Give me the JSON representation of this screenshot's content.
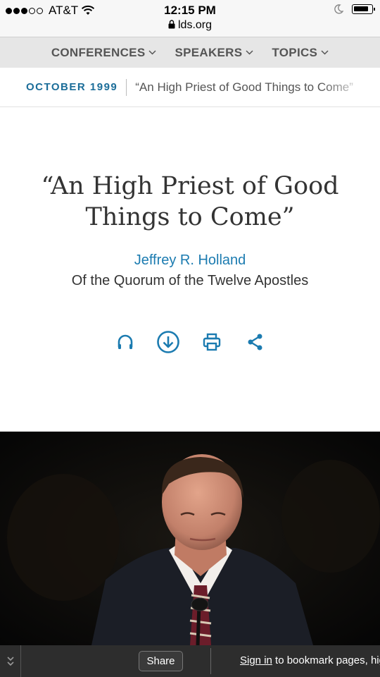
{
  "status_bar": {
    "carrier": "AT&T",
    "time": "12:15 PM",
    "url": "lds.org",
    "signal_bars_filled": 3,
    "signal_bars_total": 5
  },
  "nav": {
    "items": [
      {
        "label": "CONFERENCES"
      },
      {
        "label": "SPEAKERS"
      },
      {
        "label": "TOPICS"
      }
    ]
  },
  "breadcrumb": {
    "date": "OCTOBER 1999",
    "title": "“An High Priest of Good Things to Come”"
  },
  "talk": {
    "title_line1": "“An High Priest of Good",
    "title_line2": "Things to Come”",
    "author": "Jeffrey R. Holland",
    "role": "Of the Quorum of the Twelve Apostles"
  },
  "actions": [
    {
      "icon": "headphones-icon"
    },
    {
      "icon": "download-icon"
    },
    {
      "icon": "print-icon"
    },
    {
      "icon": "share-icon"
    }
  ],
  "bottom_bar": {
    "share_label": "Share",
    "signin_link": "Sign in",
    "signin_rest": " to bookmark pages, higl"
  },
  "colors": {
    "accent": "#1b7bb0",
    "date_accent": "#1b6d99",
    "nav_bg": "#e6e6e6",
    "bottom_bar_bg": "#2d2d2d"
  }
}
